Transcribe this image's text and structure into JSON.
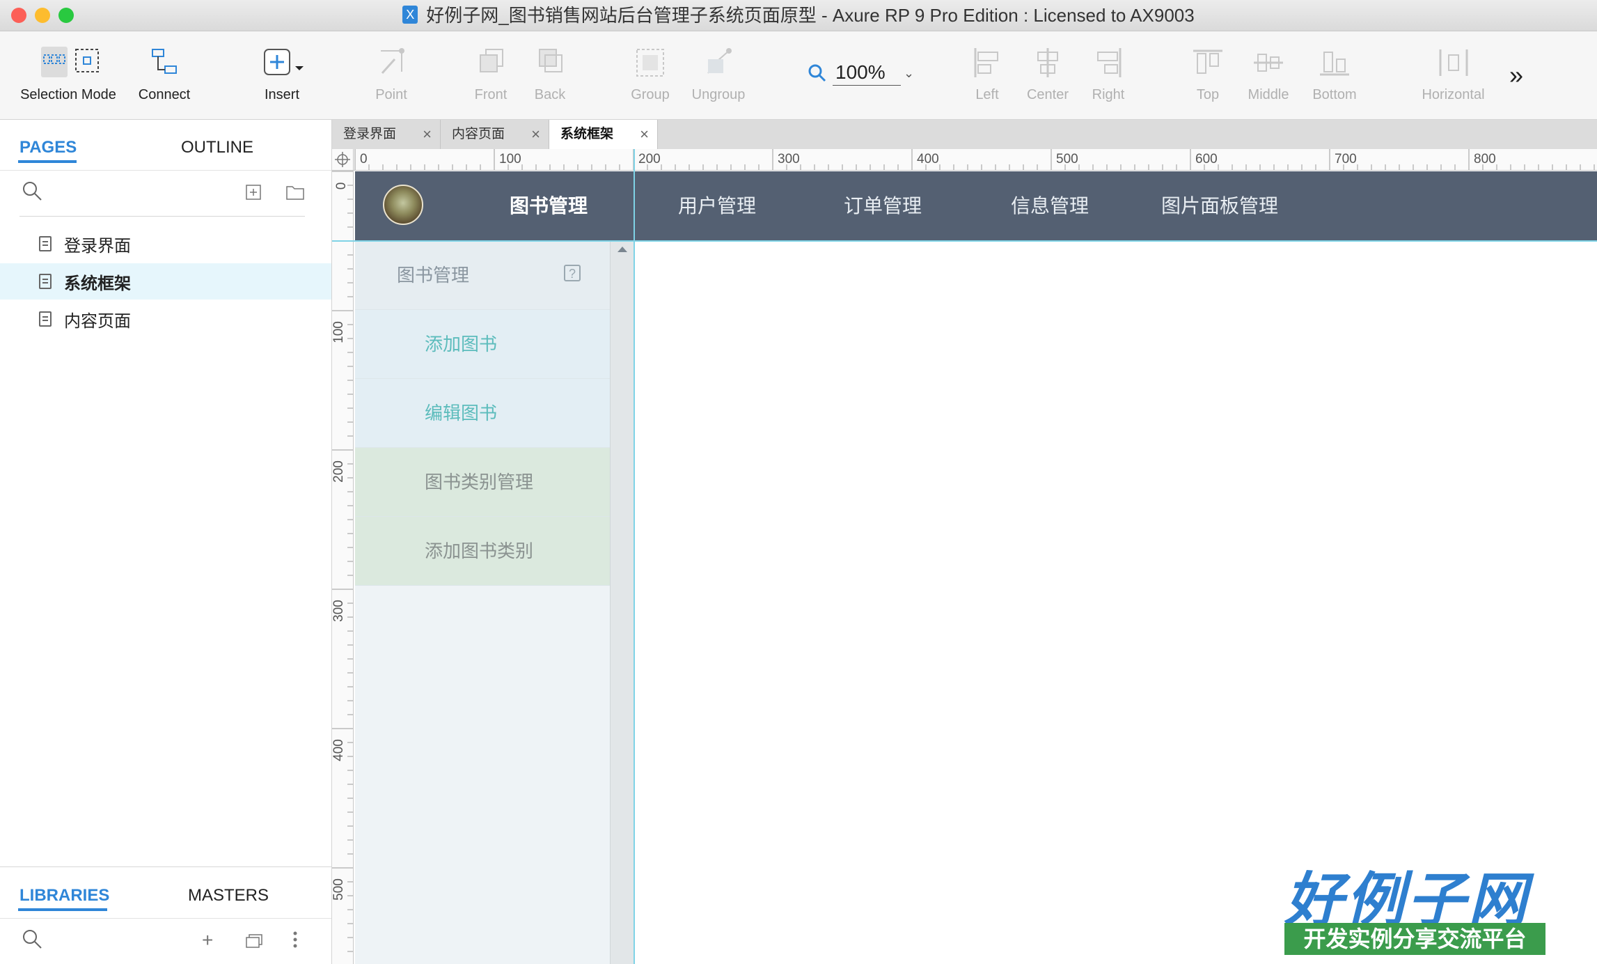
{
  "window": {
    "title": "好例子网_图书销售网站后台管理子系统页面原型 - Axure RP 9 Pro Edition : Licensed to AX9003",
    "traffic_colors": [
      "#fc5f57",
      "#fdbc2e",
      "#29c940"
    ]
  },
  "toolbar": {
    "tools": [
      {
        "label": "Selection Mode",
        "icon": "selection-mode-icon",
        "enabled": true
      },
      {
        "label": "Connect",
        "icon": "connect-icon",
        "enabled": true
      },
      {
        "label": "Insert",
        "icon": "insert-icon",
        "enabled": true
      },
      {
        "label": "Point",
        "icon": "point-icon",
        "enabled": false
      },
      {
        "label": "Front",
        "icon": "front-icon",
        "enabled": false
      },
      {
        "label": "Back",
        "icon": "back-icon",
        "enabled": false
      },
      {
        "label": "Group",
        "icon": "group-icon",
        "enabled": false
      },
      {
        "label": "Ungroup",
        "icon": "ungroup-icon",
        "enabled": false
      },
      {
        "label": "Left",
        "icon": "align-left-icon",
        "enabled": false
      },
      {
        "label": "Center",
        "icon": "align-center-icon",
        "enabled": false
      },
      {
        "label": "Right",
        "icon": "align-right-icon",
        "enabled": false
      },
      {
        "label": "Top",
        "icon": "align-top-icon",
        "enabled": false
      },
      {
        "label": "Middle",
        "icon": "align-middle-icon",
        "enabled": false
      },
      {
        "label": "Bottom",
        "icon": "align-bottom-icon",
        "enabled": false
      },
      {
        "label": "Horizontal",
        "icon": "distribute-horizontal-icon",
        "enabled": false
      }
    ],
    "zoom": "100%",
    "more": "»"
  },
  "left_panel": {
    "tabs": [
      "PAGES",
      "OUTLINE"
    ],
    "active_tab": "PAGES",
    "pages": [
      {
        "label": "登录界面",
        "selected": false
      },
      {
        "label": "系统框架",
        "selected": true
      },
      {
        "label": "内容页面",
        "selected": false
      }
    ],
    "bottom_tabs": [
      "LIBRARIES",
      "MASTERS"
    ],
    "bottom_active_tab": "LIBRARIES"
  },
  "doc_tabs": [
    {
      "label": "登录界面",
      "active": false
    },
    {
      "label": "内容页面",
      "active": false
    },
    {
      "label": "系统框架",
      "active": true
    }
  ],
  "ruler": {
    "h_labels": [
      "0",
      "100",
      "200",
      "300",
      "400",
      "500",
      "600",
      "700",
      "800"
    ],
    "v_labels": [
      "0",
      "100",
      "200",
      "300",
      "400",
      "500"
    ]
  },
  "prototype": {
    "nav": [
      "图书管理",
      "用户管理",
      "订单管理",
      "信息管理",
      "图片面板管理"
    ],
    "nav_active": "图书管理",
    "menu": [
      {
        "label": "图书管理",
        "kind": "header"
      },
      {
        "label": "添加图书",
        "kind": "sub"
      },
      {
        "label": "编辑图书",
        "kind": "sub"
      },
      {
        "label": "图书类别管理",
        "kind": "sub2"
      },
      {
        "label": "添加图书类别",
        "kind": "sub2"
      }
    ],
    "nav_bg": "#546072",
    "accent": "#5cbcbc"
  },
  "watermark": {
    "logo": "好例子网",
    "tagline": "开发实例分享交流平台"
  }
}
